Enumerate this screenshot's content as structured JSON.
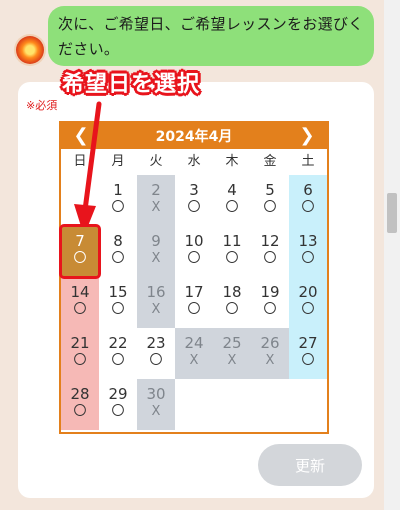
{
  "chat": {
    "message": "次に、ご希望日、ご希望レッスンをお選びください。"
  },
  "annotation": {
    "label": "希望日を選択",
    "color": "#e8141c"
  },
  "form": {
    "required_label": "※必須",
    "update_button": "更新"
  },
  "calendar": {
    "title": "2024年4月",
    "prev_icon": "chevron-left-icon",
    "next_icon": "chevron-right-icon",
    "weekdays": [
      "日",
      "月",
      "火",
      "水",
      "木",
      "金",
      "土"
    ],
    "accent_color": "#e3801c",
    "weeks": [
      [
        {
          "day": "",
          "mark": "",
          "status": "empty"
        },
        {
          "day": "1",
          "mark": "〇",
          "status": "available"
        },
        {
          "day": "2",
          "mark": "X",
          "status": "unavailable"
        },
        {
          "day": "3",
          "mark": "〇",
          "status": "available"
        },
        {
          "day": "4",
          "mark": "〇",
          "status": "available"
        },
        {
          "day": "5",
          "mark": "〇",
          "status": "available"
        },
        {
          "day": "6",
          "mark": "〇",
          "status": "available"
        }
      ],
      [
        {
          "day": "7",
          "mark": "〇",
          "status": "selected"
        },
        {
          "day": "8",
          "mark": "〇",
          "status": "available"
        },
        {
          "day": "9",
          "mark": "X",
          "status": "unavailable"
        },
        {
          "day": "10",
          "mark": "〇",
          "status": "available"
        },
        {
          "day": "11",
          "mark": "〇",
          "status": "available"
        },
        {
          "day": "12",
          "mark": "〇",
          "status": "available"
        },
        {
          "day": "13",
          "mark": "〇",
          "status": "available"
        }
      ],
      [
        {
          "day": "14",
          "mark": "〇",
          "status": "available"
        },
        {
          "day": "15",
          "mark": "〇",
          "status": "available"
        },
        {
          "day": "16",
          "mark": "X",
          "status": "unavailable"
        },
        {
          "day": "17",
          "mark": "〇",
          "status": "available"
        },
        {
          "day": "18",
          "mark": "〇",
          "status": "available"
        },
        {
          "day": "19",
          "mark": "〇",
          "status": "available"
        },
        {
          "day": "20",
          "mark": "〇",
          "status": "available"
        }
      ],
      [
        {
          "day": "21",
          "mark": "〇",
          "status": "available"
        },
        {
          "day": "22",
          "mark": "〇",
          "status": "available"
        },
        {
          "day": "23",
          "mark": "〇",
          "status": "available"
        },
        {
          "day": "24",
          "mark": "X",
          "status": "unavailable"
        },
        {
          "day": "25",
          "mark": "X",
          "status": "unavailable"
        },
        {
          "day": "26",
          "mark": "X",
          "status": "unavailable"
        },
        {
          "day": "27",
          "mark": "〇",
          "status": "available"
        }
      ],
      [
        {
          "day": "28",
          "mark": "〇",
          "status": "available"
        },
        {
          "day": "29",
          "mark": "〇",
          "status": "available"
        },
        {
          "day": "30",
          "mark": "X",
          "status": "unavailable"
        },
        {
          "day": "",
          "mark": "",
          "status": "empty"
        },
        {
          "day": "",
          "mark": "",
          "status": "empty"
        },
        {
          "day": "",
          "mark": "",
          "status": "empty"
        },
        {
          "day": "",
          "mark": "",
          "status": "empty"
        }
      ]
    ]
  }
}
